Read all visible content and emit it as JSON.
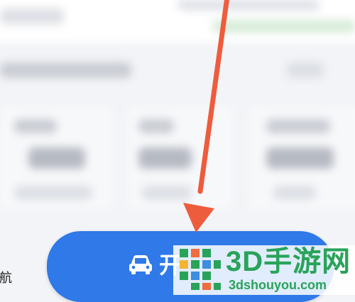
{
  "nav_button": {
    "label": "开",
    "icon": "car-icon",
    "color": "#2f79e8"
  },
  "edge_text": {
    "bottom": "航",
    "top": ")"
  },
  "annotation": {
    "arrow_color": "#ee5c3e"
  },
  "watermark": {
    "title": "3D手游网",
    "url": "3dshouyou.com",
    "color": "#29a35a"
  }
}
